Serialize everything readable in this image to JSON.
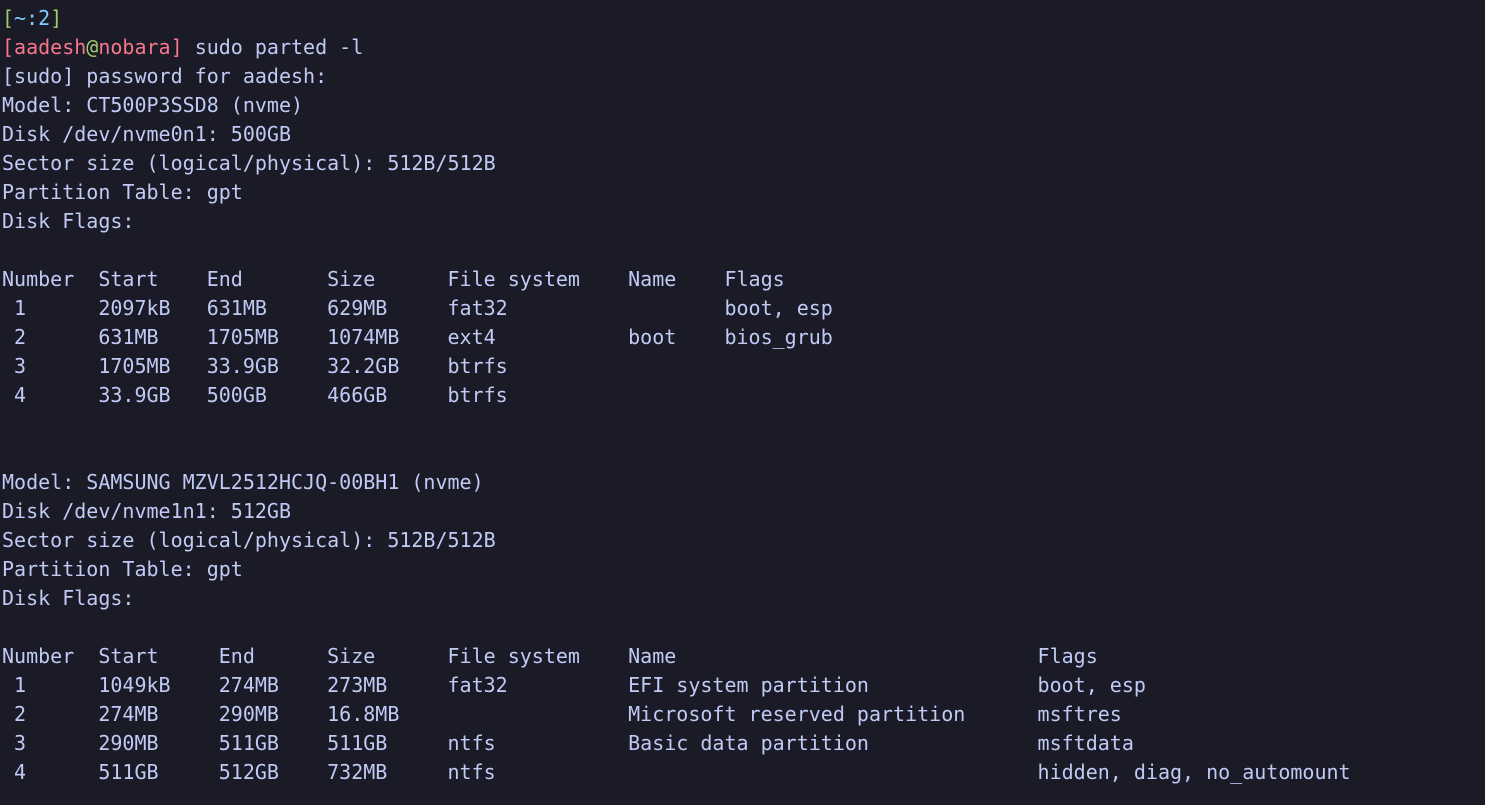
{
  "prompt": {
    "bracket_open": "[",
    "cwd": "~:2",
    "bracket_close": "]",
    "user": "aadesh",
    "at": "@",
    "host": "nobara",
    "command": "sudo parted -l"
  },
  "sudo_line": "[sudo] password for aadesh:",
  "disks": [
    {
      "model": "Model: CT500P3SSD8 (nvme)",
      "disk": "Disk /dev/nvme0n1: 500GB",
      "sector": "Sector size (logical/physical): 512B/512B",
      "ptable": "Partition Table: gpt",
      "flags": "Disk Flags:",
      "cols": {
        "number": "Number",
        "start": "Start",
        "end": "End",
        "size": "Size",
        "fs": "File system",
        "name": "Name",
        "pflags": "Flags"
      },
      "rows": [
        {
          "number": "1",
          "start": "2097kB",
          "end": "631MB",
          "size": "629MB",
          "fs": "fat32",
          "name": "",
          "pflags": "boot, esp"
        },
        {
          "number": "2",
          "start": "631MB",
          "end": "1705MB",
          "size": "1074MB",
          "fs": "ext4",
          "name": "boot",
          "pflags": "bios_grub"
        },
        {
          "number": "3",
          "start": "1705MB",
          "end": "33.9GB",
          "size": "32.2GB",
          "fs": "btrfs",
          "name": "",
          "pflags": ""
        },
        {
          "number": "4",
          "start": "33.9GB",
          "end": "500GB",
          "size": "466GB",
          "fs": "btrfs",
          "name": "",
          "pflags": ""
        }
      ]
    },
    {
      "model": "Model: SAMSUNG MZVL2512HCJQ-00BH1 (nvme)",
      "disk": "Disk /dev/nvme1n1: 512GB",
      "sector": "Sector size (logical/physical): 512B/512B",
      "ptable": "Partition Table: gpt",
      "flags": "Disk Flags:",
      "cols": {
        "number": "Number",
        "start": "Start",
        "end": "End",
        "size": "Size",
        "fs": "File system",
        "name": "Name",
        "pflags": "Flags"
      },
      "rows": [
        {
          "number": "1",
          "start": "1049kB",
          "end": "274MB",
          "size": "273MB",
          "fs": "fat32",
          "name": "EFI system partition",
          "pflags": "boot, esp"
        },
        {
          "number": "2",
          "start": "274MB",
          "end": "290MB",
          "size": "16.8MB",
          "fs": "",
          "name": "Microsoft reserved partition",
          "pflags": "msftres"
        },
        {
          "number": "3",
          "start": "290MB",
          "end": "511GB",
          "size": "511GB",
          "fs": "ntfs",
          "name": "Basic data partition",
          "pflags": "msftdata"
        },
        {
          "number": "4",
          "start": "511GB",
          "end": "512GB",
          "size": "732MB",
          "fs": "ntfs",
          "name": "",
          "pflags": "hidden, diag, no_automount"
        }
      ]
    }
  ],
  "layouts": [
    {
      "num": 2,
      "start": 7,
      "end": 8,
      "size": 8,
      "fs": 13,
      "name": 6,
      "flags": 0
    },
    {
      "num": 2,
      "start": 8,
      "end": 7,
      "size": 8,
      "fs": 13,
      "name": 32,
      "flags": 0
    }
  ]
}
